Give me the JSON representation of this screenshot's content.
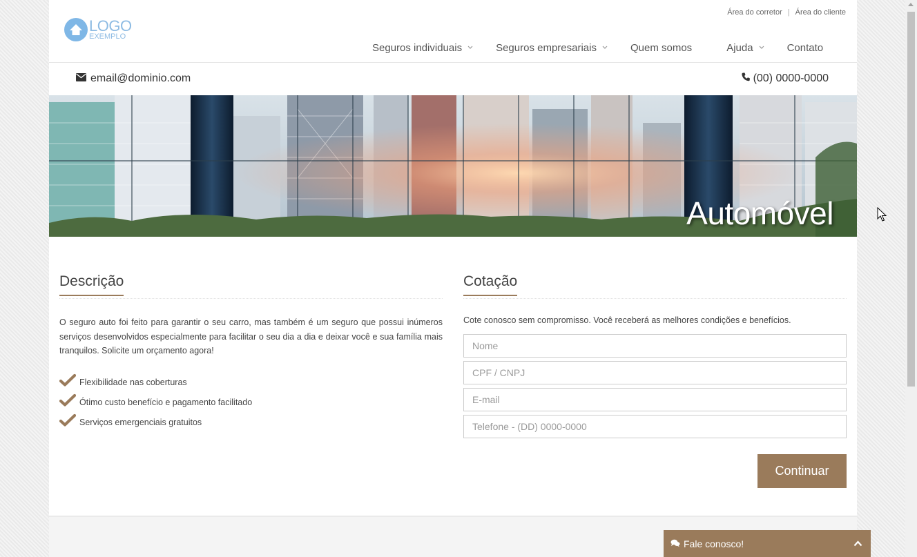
{
  "header": {
    "logo": {
      "main": "LOGO",
      "sub": "EXEMPLO"
    },
    "toplinks": [
      "Área do corretor",
      "Área do cliente"
    ],
    "toplinks_separator": "|",
    "nav": [
      {
        "label": "Seguros individuais",
        "has_dropdown": true
      },
      {
        "label": "Seguros empresariais",
        "has_dropdown": true
      },
      {
        "label": "Quem somos",
        "has_dropdown": false
      },
      {
        "label": "Ajuda",
        "has_dropdown": true
      },
      {
        "label": "Contato",
        "has_dropdown": false
      }
    ]
  },
  "contact": {
    "email": "email@dominio.com",
    "phone": "(00) 0000-0000",
    "email_icon": "envelope-icon",
    "phone_icon": "phone-icon"
  },
  "banner": {
    "title": "Automóvel"
  },
  "description": {
    "heading": "Descrição",
    "text": "O seguro auto foi feito para garantir o seu carro, mas também é um seguro que possui inúmeros serviços desenvolvidos especialmente para facilitar o seu dia a dia e deixar você e sua família mais tranquilos. Solicite um orçamento agora!",
    "features": [
      "Flexibilidade nas coberturas",
      "Ótimo custo benefício e pagamento facilitado",
      "Serviços emergenciais gratuitos"
    ]
  },
  "quote": {
    "heading": "Cotação",
    "intro": "Cote conosco sem compromisso. Você receberá as melhores condições e benefícios.",
    "fields": [
      {
        "placeholder": "Nome"
      },
      {
        "placeholder": "CPF / CNPJ"
      },
      {
        "placeholder": "E-mail"
      },
      {
        "placeholder": "Telefone - (DD) 0000-0000"
      }
    ],
    "submit_label": "Continuar"
  },
  "chat": {
    "label": "Fale conosco!",
    "icon": "chat-bubbles-icon",
    "toggle_icon": "chevron-up-icon"
  },
  "colors": {
    "accent": "#9a7b5b",
    "logo": "#8dbbe3",
    "text": "#444444"
  }
}
